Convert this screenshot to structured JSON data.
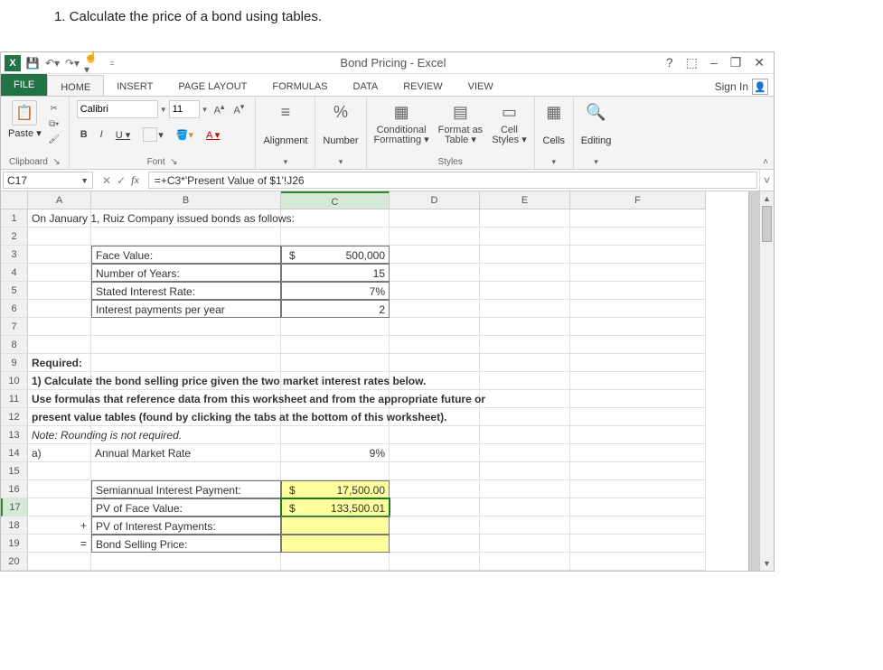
{
  "question": "1.  Calculate the price of a bond using tables.",
  "title": "Bond Pricing - Excel",
  "window": {
    "help": "?",
    "ribbon_opts": "⬚",
    "min": "–",
    "restore": "❐",
    "close": "✕"
  },
  "tabs": {
    "file": "FILE",
    "home": "HOME",
    "insert": "INSERT",
    "page": "PAGE LAYOUT",
    "formulas": "FORMULAS",
    "data": "DATA",
    "review": "REVIEW",
    "view": "VIEW"
  },
  "signin": "Sign In",
  "ribbon": {
    "clipboard": {
      "paste": "Paste",
      "label": "Clipboard"
    },
    "font": {
      "name": "Calibri",
      "size": "11",
      "label": "Font"
    },
    "alignment": "Alignment",
    "number": "Number",
    "styles": {
      "cond": "Conditional Formatting",
      "fmt": "Format as Table",
      "cell": "Cell Styles",
      "label": "Styles"
    },
    "cells": "Cells",
    "editing": "Editing",
    "percent": "%"
  },
  "namebox": "C17",
  "formula": "=+C3*'Present Value of $1'!J26",
  "cols": {
    "A": "A",
    "B": "B",
    "C": "C",
    "D": "D",
    "E": "E",
    "F": "F"
  },
  "rows": {
    "r1": {
      "A": "On January 1,  Ruiz Company issued bonds as follows:"
    },
    "r3": {
      "B": "Face Value:",
      "C_sym": "$",
      "C_val": "500,000"
    },
    "r4": {
      "B": "Number of Years:",
      "C": "15"
    },
    "r5": {
      "B": "Stated Interest Rate:",
      "C": "7%"
    },
    "r6": {
      "B": "Interest payments per year",
      "C": "2"
    },
    "r9": {
      "A": "Required:"
    },
    "r10": {
      "A": "1) Calculate the bond selling price given the two market interest rates below."
    },
    "r11": {
      "A": "Use formulas that reference data from this worksheet and from the appropriate future or"
    },
    "r12": {
      "A": "present value tables (found by clicking the tabs at the bottom of this worksheet)."
    },
    "r13": {
      "A": "Note: Rounding is not required."
    },
    "r14": {
      "A": "a)",
      "B": "Annual Market Rate",
      "C": "9%"
    },
    "r16": {
      "B": "Semiannual Interest Payment:",
      "C_sym": "$",
      "C_val": "17,500.00"
    },
    "r17": {
      "B": "PV of Face Value:",
      "C_sym": "$",
      "C_val": "133,500.01"
    },
    "r18": {
      "A": "+",
      "B": "PV of Interest Payments:"
    },
    "r19": {
      "A": "=",
      "B": "Bond Selling Price:"
    }
  },
  "rownums": [
    "1",
    "2",
    "3",
    "4",
    "5",
    "6",
    "7",
    "8",
    "9",
    "10",
    "11",
    "12",
    "13",
    "14",
    "15",
    "16",
    "17",
    "18",
    "19",
    "20"
  ]
}
